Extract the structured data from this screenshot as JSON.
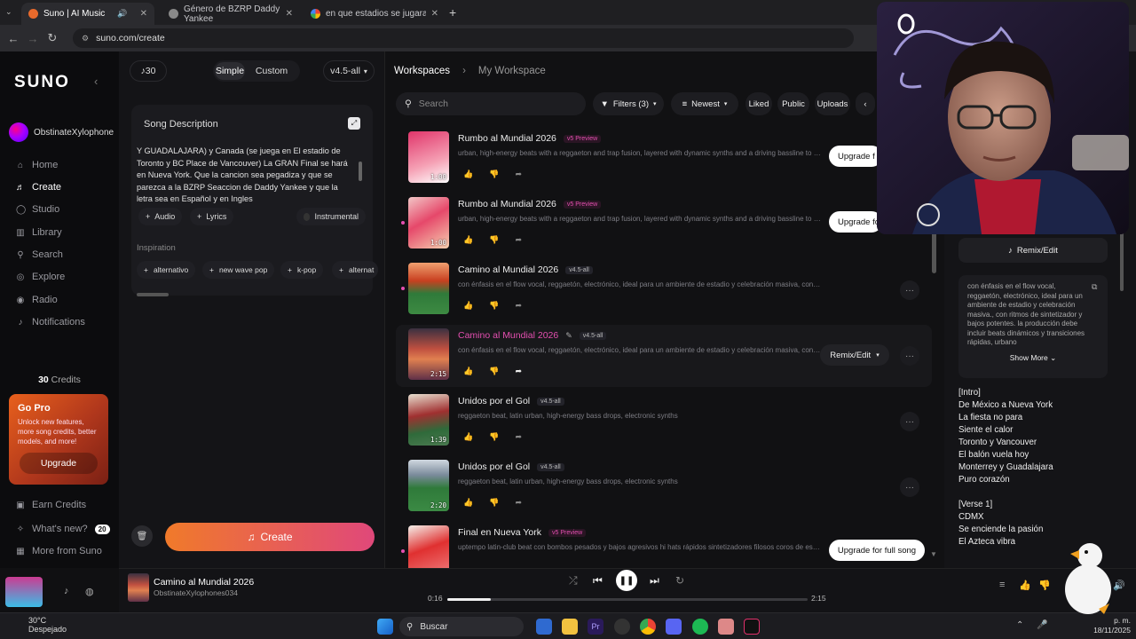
{
  "browser": {
    "tabs": [
      {
        "label": "Suno | AI Music",
        "active": true
      },
      {
        "label": "Género de BZRP Daddy Yankee",
        "active": false
      },
      {
        "label": "en que estadios se jugara el mu",
        "active": false
      }
    ],
    "url": "suno.com/create"
  },
  "sidebar": {
    "logo": "SUNO",
    "user": "ObstinateXylophone",
    "items": [
      {
        "label": "Home",
        "icon": "home-icon"
      },
      {
        "label": "Create",
        "icon": "create-icon"
      },
      {
        "label": "Studio",
        "icon": "studio-icon"
      },
      {
        "label": "Library",
        "icon": "library-icon"
      },
      {
        "label": "Search",
        "icon": "search-icon"
      },
      {
        "label": "Explore",
        "icon": "explore-icon"
      },
      {
        "label": "Radio",
        "icon": "radio-icon"
      },
      {
        "label": "Notifications",
        "icon": "bell-icon"
      }
    ],
    "credits_count": "30",
    "credits_label": "Credits",
    "gopro": {
      "title": "Go Pro",
      "desc": "Unlock new features, more song credits, better models, and more!",
      "button": "Upgrade"
    },
    "bottom": [
      {
        "label": "Earn Credits"
      },
      {
        "label": "What's new?",
        "badge": "20"
      },
      {
        "label": "More from Suno"
      }
    ]
  },
  "create": {
    "credits": "30",
    "mode_simple": "Simple",
    "mode_custom": "Custom",
    "model": "v4.5-all",
    "song_desc_title": "Song Description",
    "song_desc_text": "Y GUADALAJARA) y Canada (se juega en El estadio de Toronto y BC Place de Vancouver) La GRAN Final se hará en Nueva York. Que la cancion sea pegadiza y que se parezca a la BZRP Seaccion de Daddy Yankee y que la letra sea en Español y en Ingles",
    "audio_label": "Audio",
    "lyrics_label": "Lyrics",
    "instrumental_label": "Instrumental",
    "inspiration_title": "Inspiration",
    "inspiration": [
      "alternativo",
      "new wave pop",
      "k-pop",
      "alternat"
    ],
    "create_button": "Create"
  },
  "workspace": {
    "crumb_root": "Workspaces",
    "crumb_current": "My Workspace",
    "search_placeholder": "Search",
    "filters": [
      "Filters (3)",
      "Newest",
      "Liked",
      "Public",
      "Uploads"
    ],
    "songs": [
      {
        "title": "Rumbo al Mundial 2026",
        "badge": "v5 Preview",
        "desc": "urban, high-energy beats with a reggaeton and trap fusion, layered with dynamic synths and a driving bassline to pump ...",
        "duration": "1:00",
        "action": "Upgrade f"
      },
      {
        "title": "Rumbo al Mundial 2026",
        "badge": "v5 Preview",
        "desc": "urban, high-energy beats with a reggaeton and trap fusion, layered with dynamic synths and a driving bassline to pump ...",
        "duration": "1:00",
        "action": "Upgrade fo"
      },
      {
        "title": "Camino al Mundial 2026",
        "badge": "v4.5-all",
        "desc": "con énfasis en el flow vocal, reggaetón, electrónico, ideal para un ambiente de estadio y celebración masiva, con rit...",
        "duration": "",
        "action": ""
      },
      {
        "title": "Camino al Mundial 2026",
        "badge": "v4.5-all",
        "desc": "con énfasis en el flow vocal, reggaetón, electrónico, ideal para un ambiente de estadio y celebración masiva, con rit...",
        "duration": "2:15",
        "action": "Remix/Edit"
      },
      {
        "title": "Unidos por el Gol",
        "badge": "v4.5-all",
        "desc": "reggaeton beat, latin urban, high-energy bass drops, electronic synths",
        "duration": "1:39",
        "action": ""
      },
      {
        "title": "Unidos por el Gol",
        "badge": "v4.5-all",
        "desc": "reggaeton beat, latin urban, high-energy bass drops, electronic synths",
        "duration": "2:20",
        "action": ""
      },
      {
        "title": "Final en Nueva York",
        "badge": "v5 Preview",
        "desc": "uptempo latin-club beat con bombos pesados y bajos agresivos hi hats rápidos sintetizadores filosos coros de estadio ...",
        "duration": "",
        "action": "Upgrade for full song"
      }
    ]
  },
  "details": {
    "remix_button": "Remix/Edit",
    "tags_text": "con énfasis en el flow vocal, reggaetón, electrónico, ideal para un ambiente de estadio y celebración masiva., con ritmos de sintetizador y bajos potentes. la producción debe incluir beats dinámicos y transiciones rápidas, urbano",
    "show_more": "Show More",
    "lyrics": [
      "[Intro]",
      "De México a Nueva York",
      "La fiesta no para",
      "Siente el calor",
      "Toronto y Vancouver",
      "El balón vuela hoy",
      "Monterrey y Guadalajara",
      "Puro corazón",
      "",
      "[Verse 1]",
      "CDMX",
      "Se enciende la pasión",
      "El Azteca vibra"
    ]
  },
  "player": {
    "title": "Camino al Mundial 2026",
    "artist": "ObstinateXylophones034",
    "elapsed": "0:16",
    "total": "2:15",
    "progress": 0.12
  },
  "taskbar": {
    "temperature": "30°C",
    "weather": "Despejado",
    "search": "Buscar",
    "time": "p. m.",
    "date": "18/11/2025"
  },
  "colors": {
    "accent": "#e44fb0",
    "create_gradient_start": "#f07a2a",
    "create_gradient_end": "#e0487a",
    "gopro": "#d0501c"
  }
}
